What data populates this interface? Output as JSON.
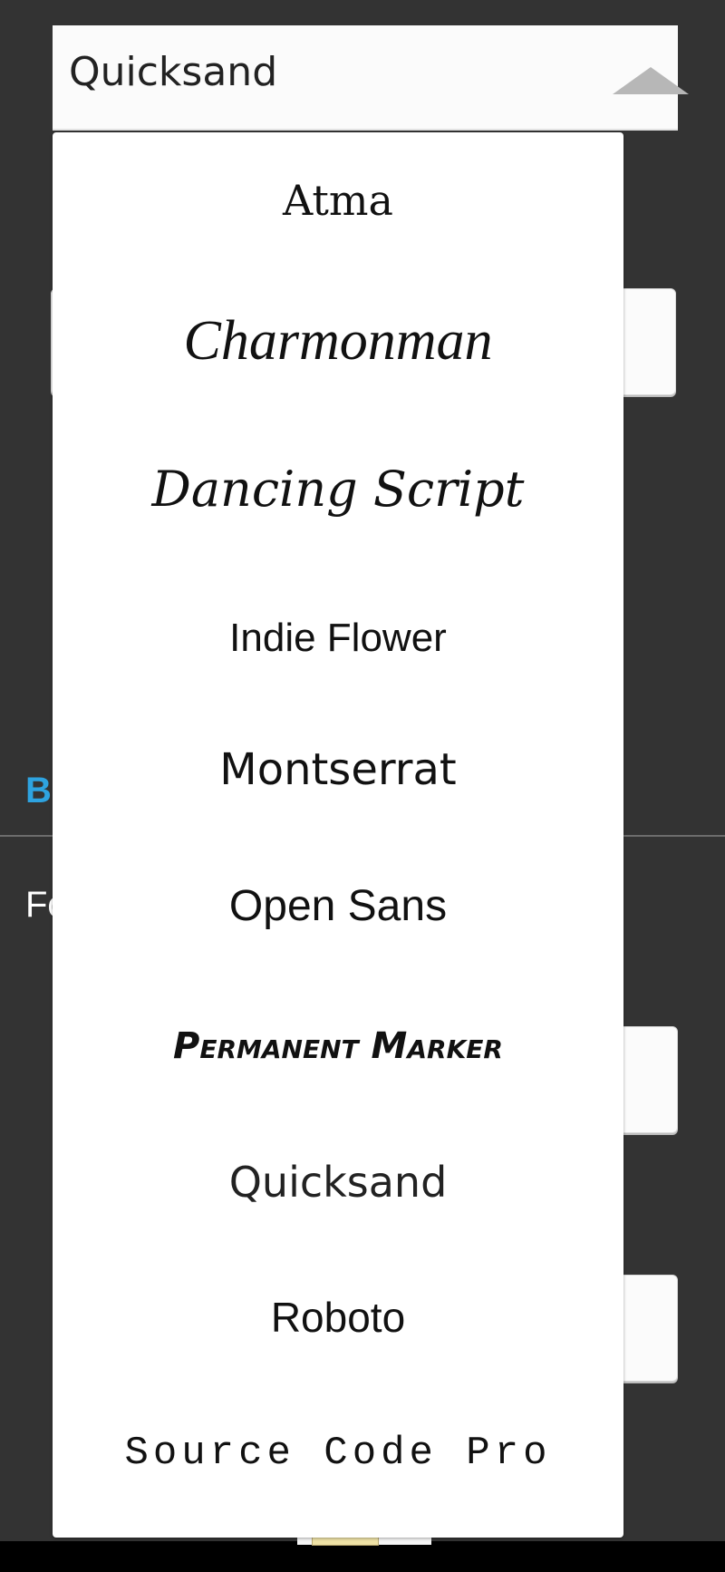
{
  "select": {
    "value": "Quicksand"
  },
  "options": [
    {
      "label": "Atma"
    },
    {
      "label": "Charmonman"
    },
    {
      "label": "Dancing Script"
    },
    {
      "label": "Indie Flower"
    },
    {
      "label": "Montserrat"
    },
    {
      "label": "Open Sans"
    },
    {
      "label": "Permanent Marker"
    },
    {
      "label": "Quicksand"
    },
    {
      "label": "Roboto"
    },
    {
      "label": "Source Code Pro"
    }
  ],
  "background": {
    "section_letter": "B",
    "label_partial": "Fo"
  },
  "colors": {
    "page_background": "#333333",
    "accent": "#2ea3e0",
    "field_background": "#fbfbfb",
    "dropdown_background": "#ffffff"
  },
  "icons": {
    "select_toggle": "caret-up-icon"
  }
}
